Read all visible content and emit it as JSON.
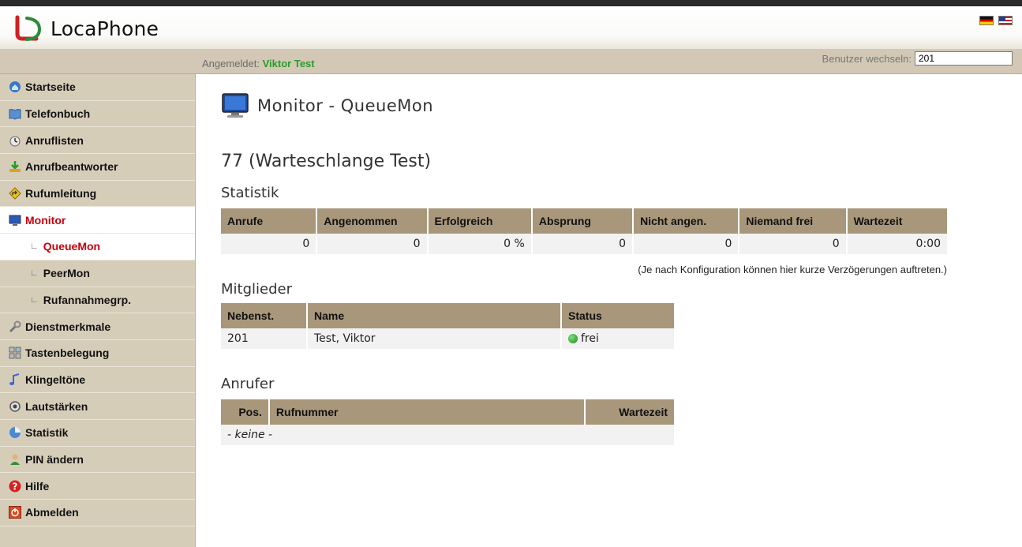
{
  "app": {
    "name": "LocaPhone"
  },
  "header": {
    "login_label": "Angemeldet:",
    "user_name": "Viktor Test",
    "switch_label": "Benutzer wechseln:",
    "switch_value": "201",
    "flags": [
      "de-flag",
      "us-flag"
    ]
  },
  "sidebar": {
    "items": [
      {
        "label": "Startseite",
        "icon": "home-icon"
      },
      {
        "label": "Telefonbuch",
        "icon": "book-icon"
      },
      {
        "label": "Anruflisten",
        "icon": "call-list-icon"
      },
      {
        "label": "Anrufbeantworter",
        "icon": "voicemail-icon"
      },
      {
        "label": "Rufumleitung",
        "icon": "redirect-icon"
      },
      {
        "label": "Monitor",
        "icon": "monitor-icon",
        "active": true
      },
      {
        "label": "QueueMon",
        "sub": true,
        "active": true
      },
      {
        "label": "PeerMon",
        "sub": true
      },
      {
        "label": "Rufannahmegrp.",
        "sub": true
      },
      {
        "label": "Dienstmerkmale",
        "icon": "wrench-icon"
      },
      {
        "label": "Tastenbelegung",
        "icon": "keypad-icon"
      },
      {
        "label": "Klingeltöne",
        "icon": "music-note-icon"
      },
      {
        "label": "Lautstärken",
        "icon": "speaker-icon"
      },
      {
        "label": "Statistik",
        "icon": "statistics-icon"
      },
      {
        "label": "PIN ändern",
        "icon": "user-pin-icon"
      },
      {
        "label": "Hilfe",
        "icon": "help-icon"
      },
      {
        "label": "Abmelden",
        "icon": "logout-icon"
      }
    ]
  },
  "main": {
    "page_title": "Monitor - QueueMon",
    "queue_title": "77 (Warteschlange Test)",
    "statistik": {
      "heading": "Statistik",
      "headers": [
        "Anrufe",
        "Angenommen",
        "Erfolgreich",
        "Absprung",
        "Nicht angen.",
        "Niemand frei",
        "Wartezeit"
      ],
      "values": [
        "0",
        "0",
        "0 %",
        "0",
        "0",
        "0",
        "0:00"
      ],
      "note": "(Je nach Konfiguration können hier kurze Verzögerungen auftreten.)"
    },
    "mitglieder": {
      "heading": "Mitglieder",
      "headers": [
        "Nebenst.",
        "Name",
        "Status"
      ],
      "rows": [
        {
          "ext": "201",
          "name": "Test, Viktor",
          "status": "frei",
          "status_color": "#1a8a1a"
        }
      ]
    },
    "anrufer": {
      "heading": "Anrufer",
      "headers": [
        "Pos.",
        "Rufnummer",
        "Wartezeit"
      ],
      "empty": "- keine -"
    }
  },
  "colors": {
    "sidebar_bg": "#d6cdb9",
    "table_header": "#a8977a",
    "active_text": "#c8000a",
    "login_name": "#2d9a2d"
  }
}
